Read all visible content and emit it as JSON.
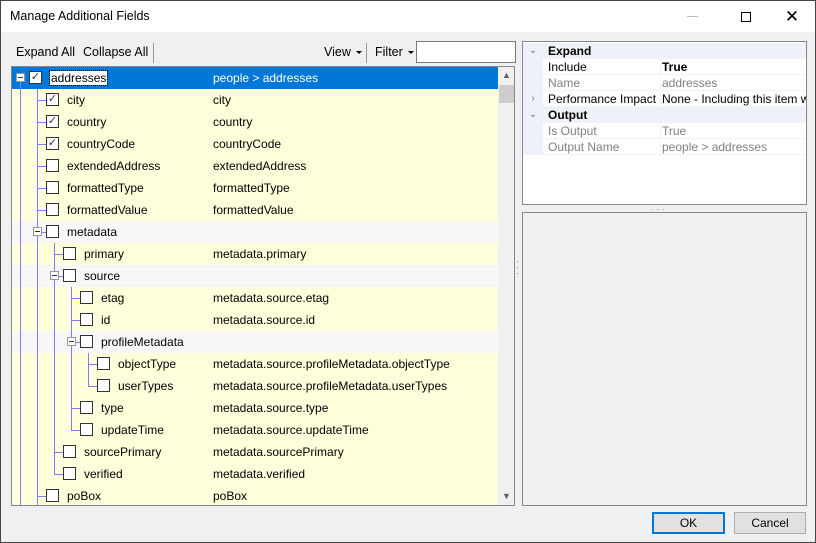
{
  "window": {
    "title": "Manage Additional Fields",
    "controls": {
      "minimize": "minimize-icon",
      "maximize": "maximize-icon",
      "close": "close-icon"
    }
  },
  "toolbar": {
    "expand_all": "Expand All",
    "collapse_all": "Collapse All",
    "view": "View",
    "filter": "Filter",
    "filter_value": ""
  },
  "tree": {
    "rows": [
      {
        "level": 0,
        "group": true,
        "checked": true,
        "selected": true,
        "name": "addresses",
        "path": "people > addresses"
      },
      {
        "level": 1,
        "checked": true,
        "name": "city",
        "path": "city"
      },
      {
        "level": 1,
        "checked": true,
        "name": "country",
        "path": "country"
      },
      {
        "level": 1,
        "checked": true,
        "name": "countryCode",
        "path": "countryCode"
      },
      {
        "level": 1,
        "checked": false,
        "name": "extendedAddress",
        "path": "extendedAddress"
      },
      {
        "level": 1,
        "checked": false,
        "name": "formattedType",
        "path": "formattedType"
      },
      {
        "level": 1,
        "checked": false,
        "name": "formattedValue",
        "path": "formattedValue"
      },
      {
        "level": 1,
        "group": true,
        "checked": false,
        "name": "metadata",
        "path": ""
      },
      {
        "level": 2,
        "checked": false,
        "name": "primary",
        "path": "metadata.primary"
      },
      {
        "level": 2,
        "group": true,
        "checked": false,
        "name": "source",
        "path": ""
      },
      {
        "level": 3,
        "checked": false,
        "name": "etag",
        "path": "metadata.source.etag"
      },
      {
        "level": 3,
        "checked": false,
        "name": "id",
        "path": "metadata.source.id"
      },
      {
        "level": 3,
        "group": true,
        "checked": false,
        "name": "profileMetadata",
        "path": ""
      },
      {
        "level": 4,
        "checked": false,
        "name": "objectType",
        "path": "metadata.source.profileMetadata.objectType"
      },
      {
        "level": 4,
        "checked": false,
        "name": "userTypes",
        "path": "metadata.source.profileMetadata.userTypes"
      },
      {
        "level": 3,
        "checked": false,
        "name": "type",
        "path": "metadata.source.type"
      },
      {
        "level": 3,
        "checked": false,
        "name": "updateTime",
        "path": "metadata.source.updateTime"
      },
      {
        "level": 2,
        "checked": false,
        "name": "sourcePrimary",
        "path": "metadata.sourcePrimary"
      },
      {
        "level": 2,
        "checked": false,
        "name": "verified",
        "path": "metadata.verified"
      },
      {
        "level": 1,
        "checked": false,
        "name": "poBox",
        "path": "poBox"
      }
    ]
  },
  "properties": [
    {
      "category": true,
      "expanded": true,
      "label": "Expand"
    },
    {
      "label": "Include",
      "value": "True",
      "bold": true
    },
    {
      "label": "Name",
      "value": "addresses",
      "readonly": true
    },
    {
      "label": "Performance Impact",
      "value": "None - Including this item will have",
      "expandable": true
    },
    {
      "category": true,
      "expanded": true,
      "label": "Output"
    },
    {
      "label": "Is Output",
      "value": "True",
      "readonly": true
    },
    {
      "label": "Output Name",
      "value": "people > addresses",
      "readonly": true
    }
  ],
  "buttons": {
    "ok": "OK",
    "cancel": "Cancel"
  },
  "colors": {
    "selection": "#0078d7",
    "leaf_row": "#ffffdc",
    "tree_lines": "#7d7dfa"
  }
}
